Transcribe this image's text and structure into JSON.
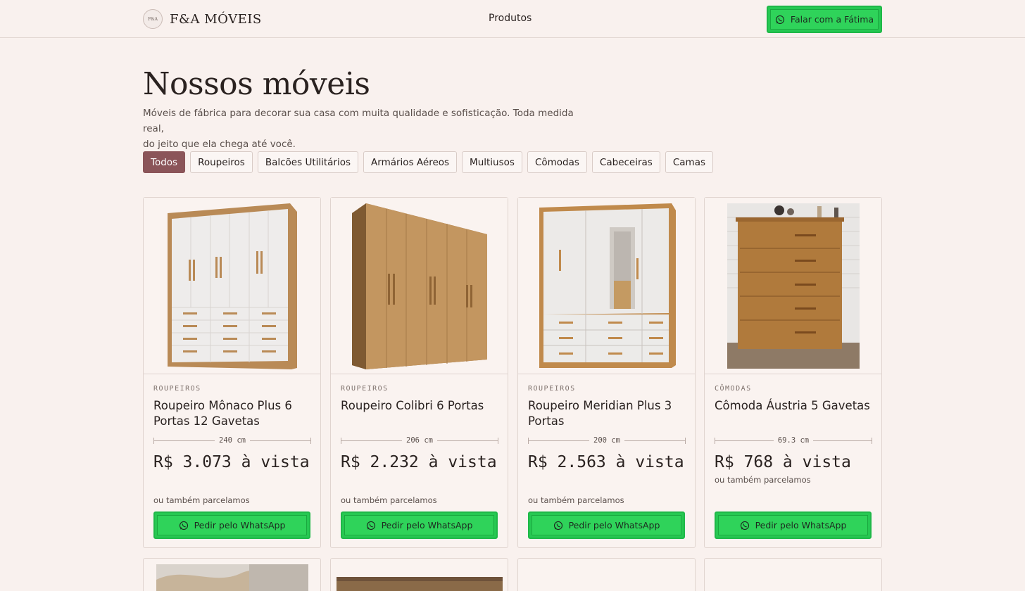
{
  "header": {
    "brand": "F&A MÓVEIS",
    "badge_text": "F&A",
    "nav_products": "Produtos",
    "cta_label": "Falar com a Fátima"
  },
  "hero": {
    "title": "Nossos móveis",
    "subtitle_line1": "Móveis de fábrica para decorar sua casa com muita qualidade e sofisticação. Toda medida real,",
    "subtitle_line2": "do jeito que ela chega até você."
  },
  "filters": [
    {
      "label": "Todos",
      "active": true
    },
    {
      "label": "Roupeiros"
    },
    {
      "label": "Balcões Utilitários"
    },
    {
      "label": "Armários Aéreos"
    },
    {
      "label": "Multiusos"
    },
    {
      "label": "Cômodas"
    },
    {
      "label": "Cabeceiras"
    },
    {
      "label": "Camas"
    }
  ],
  "products": [
    {
      "category": "ROUPEIROS",
      "title": "Roupeiro Mônaco Plus 6 Portas 12 Gavetas",
      "width": "240 cm",
      "price": "R$ 3.073 à vista",
      "installment": "ou também parcelamos",
      "button": "Pedir pelo WhatsApp"
    },
    {
      "category": "ROUPEIROS",
      "title": "Roupeiro Colibri 6 Portas",
      "width": "206 cm",
      "price": "R$ 2.232 à vista",
      "installment": "ou também parcelamos",
      "button": "Pedir pelo WhatsApp"
    },
    {
      "category": "ROUPEIROS",
      "title": "Roupeiro Meridian Plus 3 Portas",
      "width": "200 cm",
      "price": "R$ 2.563 à vista",
      "installment": "ou também parcelamos",
      "button": "Pedir pelo WhatsApp"
    },
    {
      "category": "CÔMODAS",
      "title": "Cômoda Áustria 5 Gavetas",
      "width": "69.3 cm",
      "price": "R$ 768 à vista",
      "installment": "ou também parcelamos",
      "button": "Pedir pelo WhatsApp"
    }
  ],
  "colors": {
    "background": "#f9f1ee",
    "accent": "#8b5559",
    "whatsapp_green": "#2fd35a"
  },
  "icons": {
    "cta": "whatsapp-icon"
  }
}
